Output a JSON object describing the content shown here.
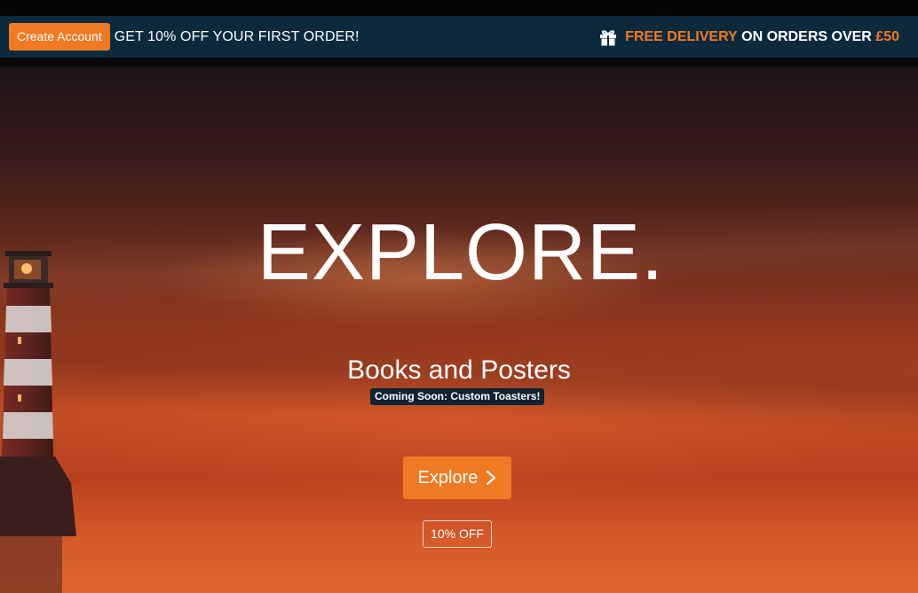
{
  "promo_bar": {
    "create_account_label": "Create Account",
    "first_order_text": "GET 10% OFF YOUR FIRST ORDER!",
    "delivery_highlight": "FREE DELIVERY",
    "delivery_text": " ON ORDERS OVER ",
    "delivery_amount": "£50",
    "gift_icon": "gift-icon"
  },
  "hero": {
    "headline": "EXPLORE.",
    "subtitle": "Books and Posters",
    "coming_soon": "Coming Soon: Custom Toasters!",
    "explore_label": "Explore",
    "explore_icon": "chevron-right-icon",
    "discount_badge": "10% OFF"
  },
  "colors": {
    "accent": "#f07a24",
    "promo_bg": "#0d2a3d",
    "badge_bg": "#0f2230"
  }
}
